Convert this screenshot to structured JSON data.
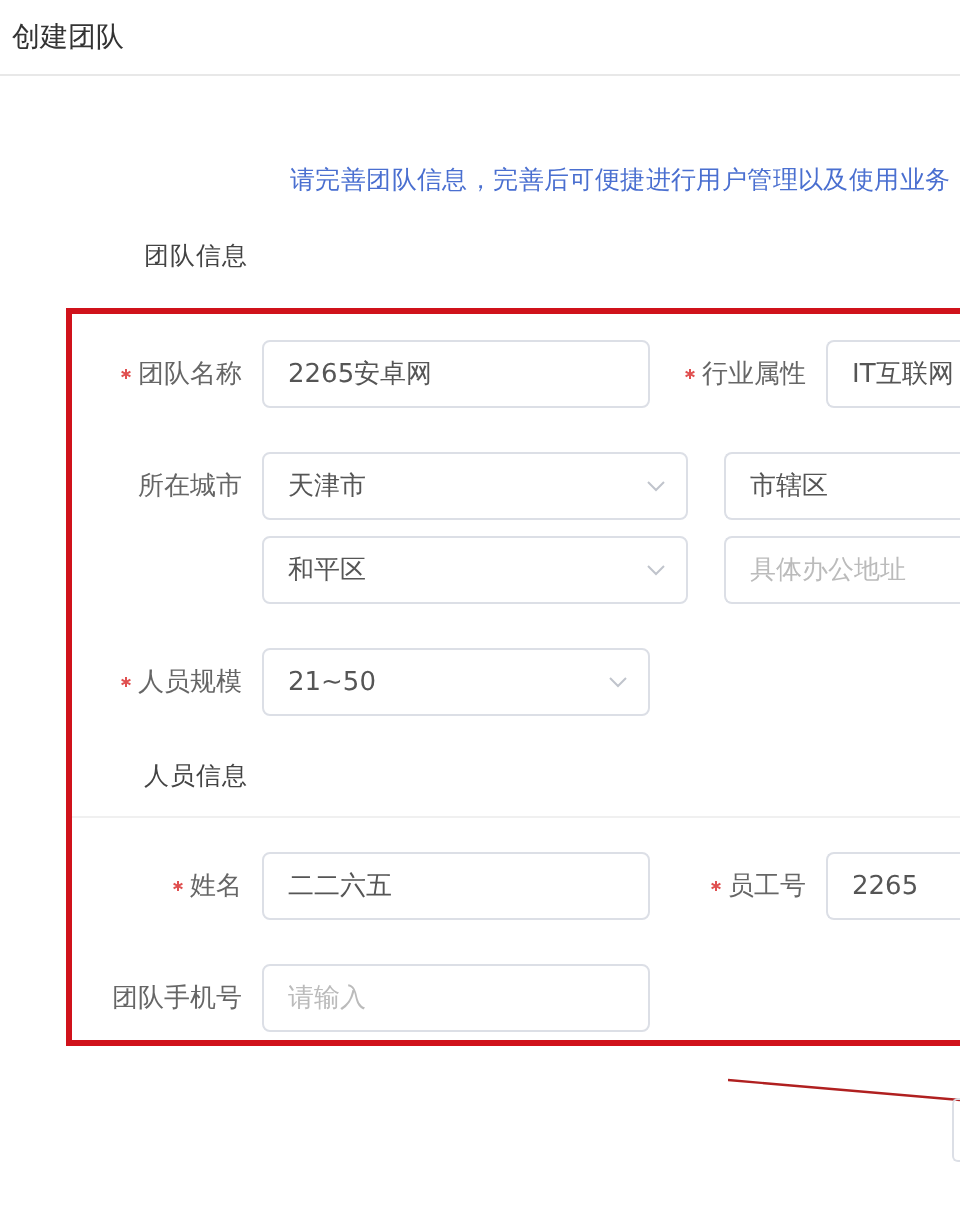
{
  "page_title": "创建团队",
  "notice": "请完善团队信息，完善后可便捷进行用户管理以及使用业务",
  "team_info": {
    "title": "团队信息",
    "rows": [
      {
        "kind": "pair",
        "label": "团队名称",
        "required": true,
        "field": {
          "dropdown": false,
          "value": "2265安卓网"
        },
        "side": {
          "label": "行业属性",
          "required": true,
          "field": {
            "value": "IT互联网"
          }
        }
      },
      {
        "kind": "address",
        "label": "所在城市",
        "required": false,
        "fields": [
          {
            "dropdown": true,
            "value": "天津市"
          },
          {
            "dropdown": false,
            "value": "市辖区"
          },
          {
            "dropdown": true,
            "value": "和平区"
          },
          {
            "dropdown": false,
            "placeholder": "具体办公地址"
          }
        ]
      },
      {
        "kind": "pair",
        "label": "人员规模",
        "required": true,
        "field": {
          "dropdown": true,
          "value": "21~50"
        }
      }
    ]
  },
  "staff_info": {
    "title": "人员信息",
    "rows": [
      {
        "kind": "pair",
        "label": "姓名",
        "required": true,
        "field": {
          "dropdown": false,
          "value": "二二六五"
        },
        "side": {
          "label": "员工号",
          "required": true,
          "field": {
            "value": "2265"
          }
        }
      },
      {
        "kind": "pair",
        "label": "团队手机号",
        "required": false,
        "field": {
          "dropdown": false,
          "placeholder": "请输入"
        }
      }
    ]
  }
}
